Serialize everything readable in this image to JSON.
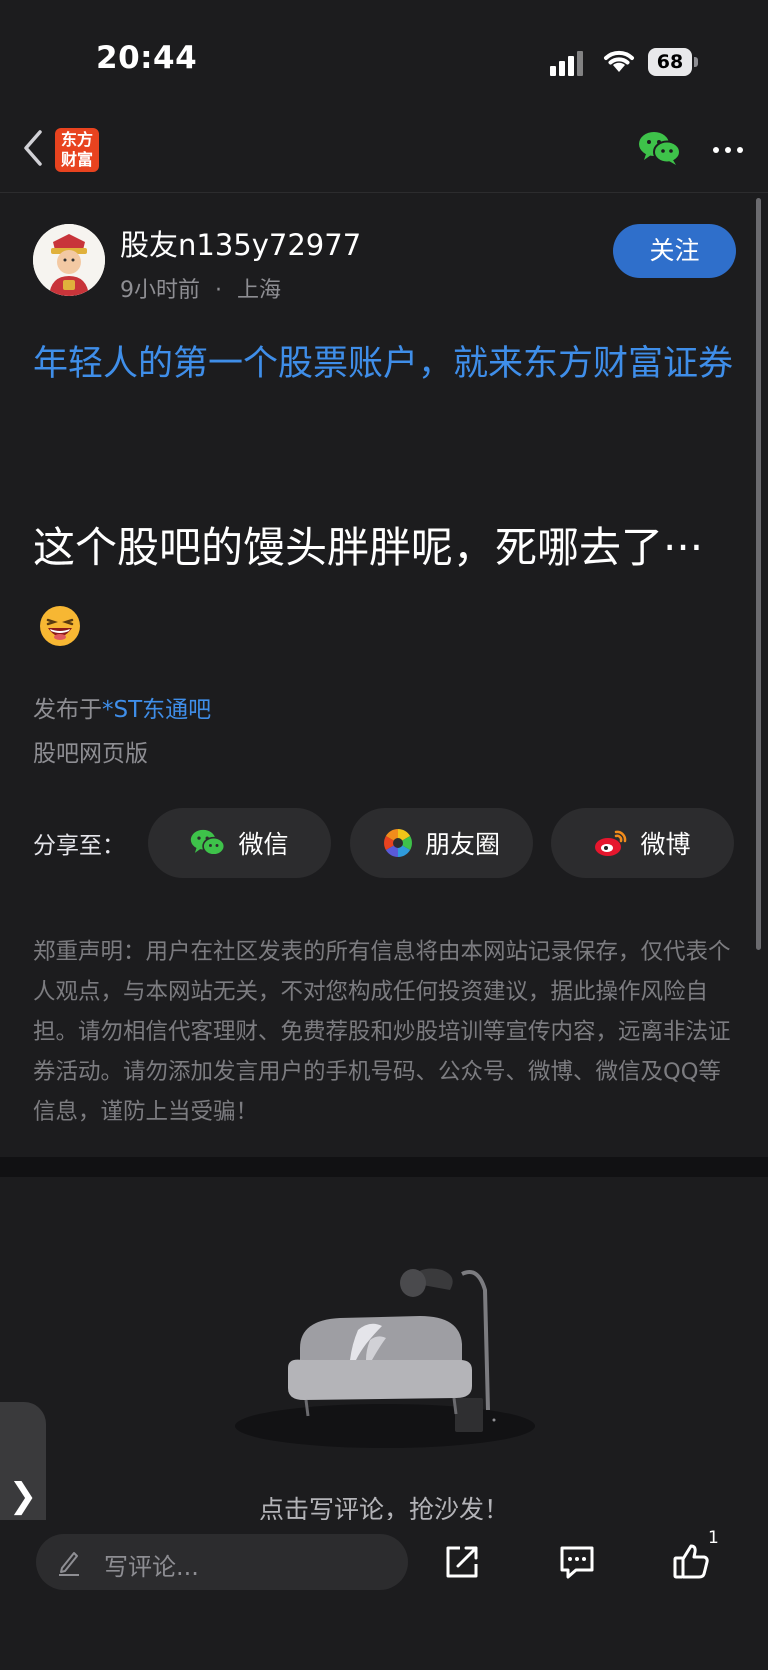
{
  "status_bar": {
    "time": "20:44",
    "battery": "68"
  },
  "nav": {
    "logo_text_line1": "东方",
    "logo_text_line2": "财富"
  },
  "post": {
    "username": "股友n135y72977",
    "time_ago": "9小时前",
    "dot": "·",
    "location": "上海",
    "follow_label": "关注",
    "promo": "年轻人的第一个股票账户，就来东方财富证券",
    "content": "这个股吧的馒头胖胖呢，死哪去了···",
    "posted_prefix": "发布于",
    "posted_board": "*ST东通吧",
    "web_version": "股吧网页版"
  },
  "share": {
    "label": "分享至：",
    "buttons": [
      {
        "label": "微信",
        "icon": "wechat-icon"
      },
      {
        "label": "朋友圈",
        "icon": "moments-icon"
      },
      {
        "label": "微博",
        "icon": "weibo-icon"
      }
    ]
  },
  "disclaimer": "郑重声明：用户在社区发表的所有信息将由本网站记录保存，仅代表个人观点，与本网站无关，不对您构成任何投资建议，据此操作风险自担。请勿相信代客理财、免费荐股和炒股培训等宣传内容，远离非法证券活动。请勿添加发言用户的手机号码、公众号、微博、微信及QQ等信息，谨防上当受骗！",
  "comments": {
    "empty_text": "点击写评论，抢沙发！"
  },
  "bottom_bar": {
    "comment_placeholder": "写评论...",
    "like_count": "1"
  },
  "side_tab": {
    "glyph": "❯"
  },
  "colors": {
    "accent_blue": "#3f8ee9",
    "follow_button": "#2f6fcb",
    "background": "#1c1c1e",
    "logo_orange": "#e8431f"
  }
}
